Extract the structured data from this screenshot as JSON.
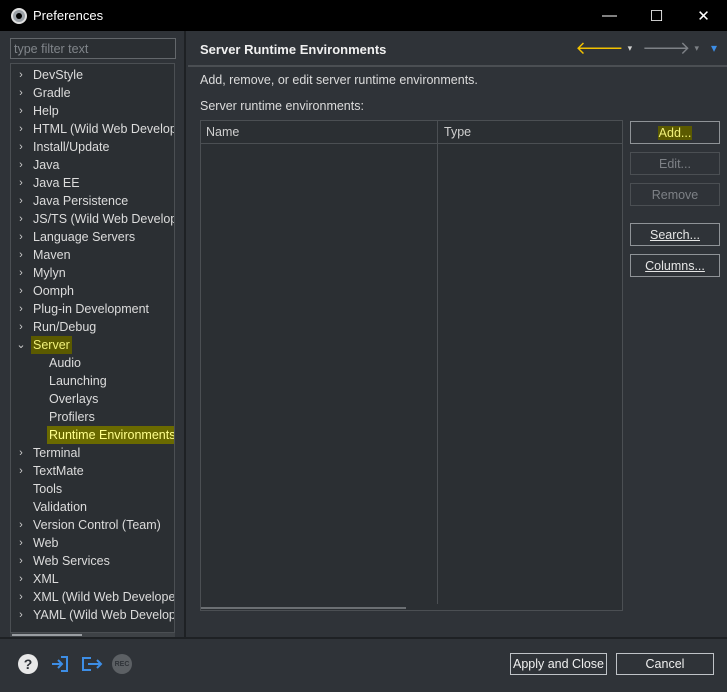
{
  "window": {
    "title": "Preferences",
    "minimize": "—",
    "maximize": "☐",
    "close": "✕"
  },
  "filter": {
    "placeholder": "type filter text",
    "value": ""
  },
  "tree": {
    "items": [
      {
        "label": "DevStyle",
        "expander": "›"
      },
      {
        "label": "Gradle",
        "expander": "›"
      },
      {
        "label": "Help",
        "expander": "›"
      },
      {
        "label": "HTML (Wild Web Develop",
        "expander": "›"
      },
      {
        "label": "Install/Update",
        "expander": "›"
      },
      {
        "label": "Java",
        "expander": "›"
      },
      {
        "label": "Java EE",
        "expander": "›"
      },
      {
        "label": "Java Persistence",
        "expander": "›"
      },
      {
        "label": "JS/TS (Wild Web Develope",
        "expander": "›"
      },
      {
        "label": "Language Servers",
        "expander": "›"
      },
      {
        "label": "Maven",
        "expander": "›"
      },
      {
        "label": "Mylyn",
        "expander": "›"
      },
      {
        "label": "Oomph",
        "expander": "›"
      },
      {
        "label": "Plug-in Development",
        "expander": "›"
      },
      {
        "label": "Run/Debug",
        "expander": "›"
      },
      {
        "label": "Server",
        "expander": "⌄",
        "highlighted": true
      },
      {
        "label": "Audio",
        "child": true
      },
      {
        "label": "Launching",
        "child": true
      },
      {
        "label": "Overlays",
        "child": true
      },
      {
        "label": "Profilers",
        "child": true
      },
      {
        "label": "Runtime Environments",
        "child": true,
        "selected": true
      },
      {
        "label": "Terminal",
        "expander": "›"
      },
      {
        "label": "TextMate",
        "expander": "›"
      },
      {
        "label": "Tools"
      },
      {
        "label": "Validation"
      },
      {
        "label": "Version Control (Team)",
        "expander": "›"
      },
      {
        "label": "Web",
        "expander": "›"
      },
      {
        "label": "Web Services",
        "expander": "›"
      },
      {
        "label": "XML",
        "expander": "›"
      },
      {
        "label": "XML (Wild Web Develope",
        "expander": "›"
      },
      {
        "label": "YAML (Wild Web Develop",
        "expander": "›"
      }
    ]
  },
  "page": {
    "title": "Server Runtime Environments",
    "back_arrow": "🡐",
    "forward_arrow": "🡒",
    "dropdown": "▾",
    "menu": "▾",
    "description": "Add, remove, or edit server runtime environments.",
    "list_label": "Server runtime environments:",
    "table": {
      "columns": [
        "Name",
        "Type"
      ],
      "rows": []
    },
    "buttons": {
      "add": "Add...",
      "edit": "Edit...",
      "remove": "Remove",
      "search": "Search...",
      "columns": "Columns..."
    }
  },
  "footer": {
    "help_glyph": "?",
    "rec_label": "REC",
    "apply_close": "Apply and Close",
    "cancel": "Cancel"
  },
  "colors": {
    "background": "#2f3338",
    "highlight": "#5b5a00",
    "accent_yellow": "#f2c200",
    "icon_blue": "#3d8ee6"
  }
}
